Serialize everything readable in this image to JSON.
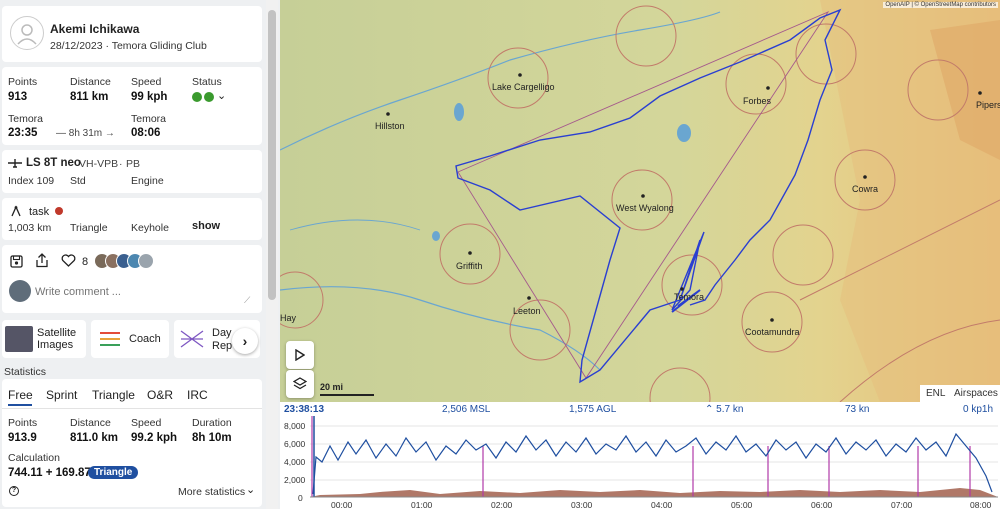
{
  "pilot": {
    "name": "Akemi Ichikawa",
    "date_club": "28/12/2023 · Temora Gliding Club"
  },
  "summary": {
    "points_label": "Points",
    "points": "913",
    "distance_label": "Distance",
    "distance": "811 km",
    "speed_label": "Speed",
    "speed": "99 kph",
    "status_label": "Status",
    "start_place": "Temora",
    "start_time": "23:35",
    "duration": "— 8h 31m →",
    "end_place": "Temora",
    "end_time": "08:06",
    "status_color": "#3a9a2e"
  },
  "aircraft": {
    "name": "LS 8T neo",
    "reg": "VH-VPB",
    "sep": "·",
    "cn": "PB",
    "index": "Index 109",
    "class": "Std",
    "engine": "Engine"
  },
  "task": {
    "label": "task",
    "distance": "1,003 km",
    "type": "Triangle",
    "sector": "Keyhole",
    "show": "show"
  },
  "social": {
    "likes": "8",
    "comment_placeholder": "Write comment ..."
  },
  "cards": [
    {
      "label": "Satellite Images"
    },
    {
      "label": "Coach"
    },
    {
      "label": "Day Rep"
    }
  ],
  "statistics": {
    "title": "Statistics",
    "tabs": [
      "Free",
      "Sprint",
      "Triangle",
      "O&R",
      "IRC"
    ],
    "points_label": "Points",
    "points": "913.9",
    "distance_label": "Distance",
    "distance": "811.0 km",
    "speed_label": "Speed",
    "speed": "99.2 kph",
    "duration_label": "Duration",
    "duration": "8h 10m",
    "calc_label": "Calculation",
    "calc": "744.11 + 169.87",
    "calc_badge": "Triangle",
    "more": "More statistics"
  },
  "map": {
    "attribution": "OpenAIP | © OpenStreetMap contributors",
    "scale": "20 mi",
    "towns": [
      "Lake Cargelligo",
      "Hillston",
      "Forbes",
      "Pipers",
      "Cowra",
      "West Wyalong",
      "Griffith",
      "Leeton",
      "Temora",
      "Cootamundra",
      "Hay"
    ]
  },
  "barogram": {
    "time": "23:38:13",
    "msl": "2,506 MSL",
    "agl": "1,575 AGL",
    "vario": "⌃ 5.7 kn",
    "ground": "73 kn",
    "wind": "0 kp1h",
    "enl": "ENL",
    "airspaces": "Airspaces",
    "y_ticks": [
      "8,000",
      "6,000",
      "4,000",
      "2,000",
      "0"
    ],
    "x_ticks": [
      "00:00",
      "01:00",
      "02:00",
      "03:00",
      "04:00",
      "05:00",
      "06:00",
      "07:00",
      "08:00"
    ]
  }
}
